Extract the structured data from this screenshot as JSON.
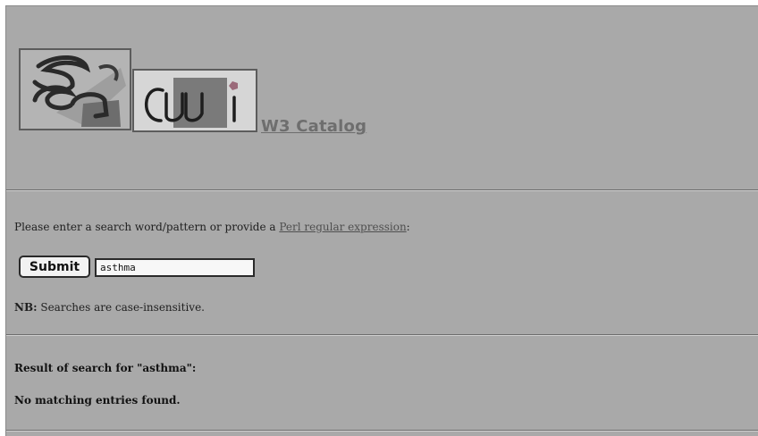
{
  "header": {
    "title_link": "W3 Catalog"
  },
  "search": {
    "prompt_text": "Please enter a search word/pattern or provide a ",
    "regex_link": "Perl regular expression",
    "prompt_suffix": ":",
    "submit_label": "Submit",
    "query_value": "asthma"
  },
  "note": {
    "bold": "NB:",
    "text": " Searches are case-insensitive."
  },
  "results": {
    "heading": "Result of search for \"asthma\":",
    "message": "No matching entries found."
  },
  "colors": {
    "page_background": "#a9a9a9"
  }
}
